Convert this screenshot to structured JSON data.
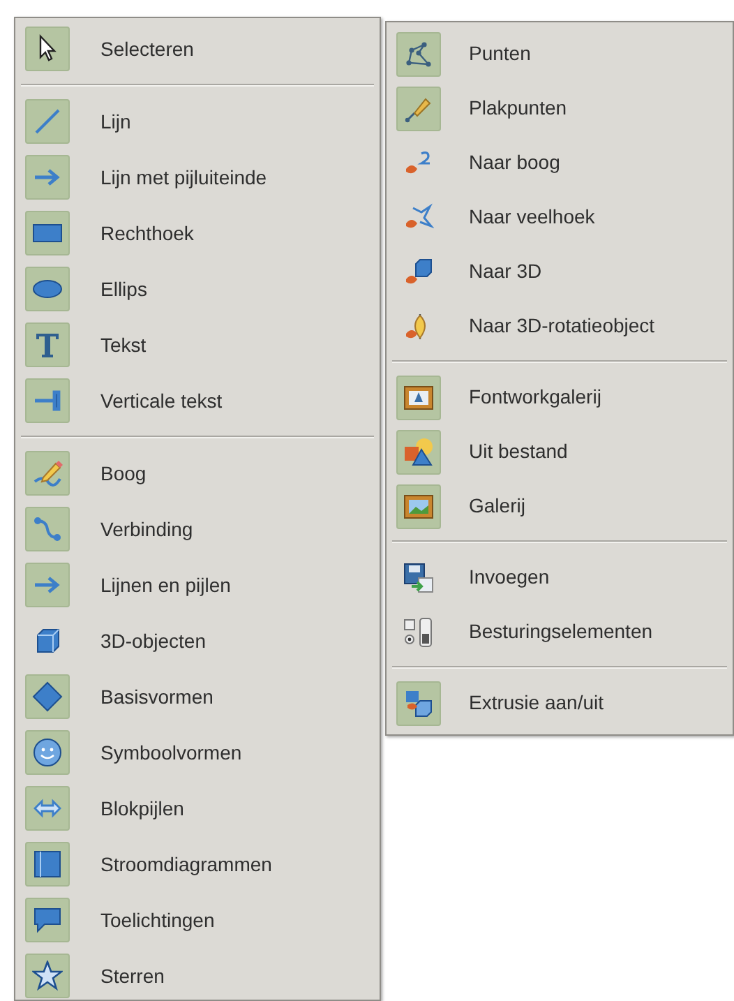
{
  "main_menu": {
    "sections": [
      [
        {
          "label": "Selecteren",
          "checked": true
        }
      ],
      [
        {
          "label": "Lijn",
          "checked": true
        },
        {
          "label": "Lijn met pijluiteinde",
          "checked": true
        },
        {
          "label": "Rechthoek",
          "checked": true
        },
        {
          "label": "Ellips",
          "checked": true
        },
        {
          "label": "Tekst",
          "checked": true
        },
        {
          "label": "Verticale tekst",
          "checked": true
        }
      ],
      [
        {
          "label": "Boog",
          "checked": true
        },
        {
          "label": "Verbinding",
          "checked": true
        },
        {
          "label": "Lijnen en pijlen",
          "checked": true
        },
        {
          "label": "3D-objecten",
          "checked": false
        },
        {
          "label": "Basisvormen",
          "checked": true
        },
        {
          "label": "Symboolvormen",
          "checked": true
        },
        {
          "label": "Blokpijlen",
          "checked": true
        },
        {
          "label": "Stroomdiagrammen",
          "checked": true
        },
        {
          "label": "Toelichtingen",
          "checked": true
        },
        {
          "label": "Sterren",
          "checked": true
        }
      ]
    ]
  },
  "submenu": {
    "sections": [
      [
        {
          "label": "Punten",
          "checked": true
        },
        {
          "label": "Plakpunten",
          "checked": true
        },
        {
          "label": "Naar boog",
          "checked": false
        },
        {
          "label": "Naar veelhoek",
          "checked": false
        },
        {
          "label": "Naar 3D",
          "checked": false
        },
        {
          "label": "Naar 3D-rotatieobject",
          "checked": false
        }
      ],
      [
        {
          "label": "Fontworkgalerij",
          "checked": true
        },
        {
          "label": "Uit bestand",
          "checked": true
        },
        {
          "label": "Galerij",
          "checked": true
        }
      ],
      [
        {
          "label": "Invoegen",
          "checked": false
        },
        {
          "label": "Besturingselementen",
          "checked": false
        }
      ],
      [
        {
          "label": "Extrusie aan/uit",
          "checked": true
        }
      ]
    ]
  }
}
